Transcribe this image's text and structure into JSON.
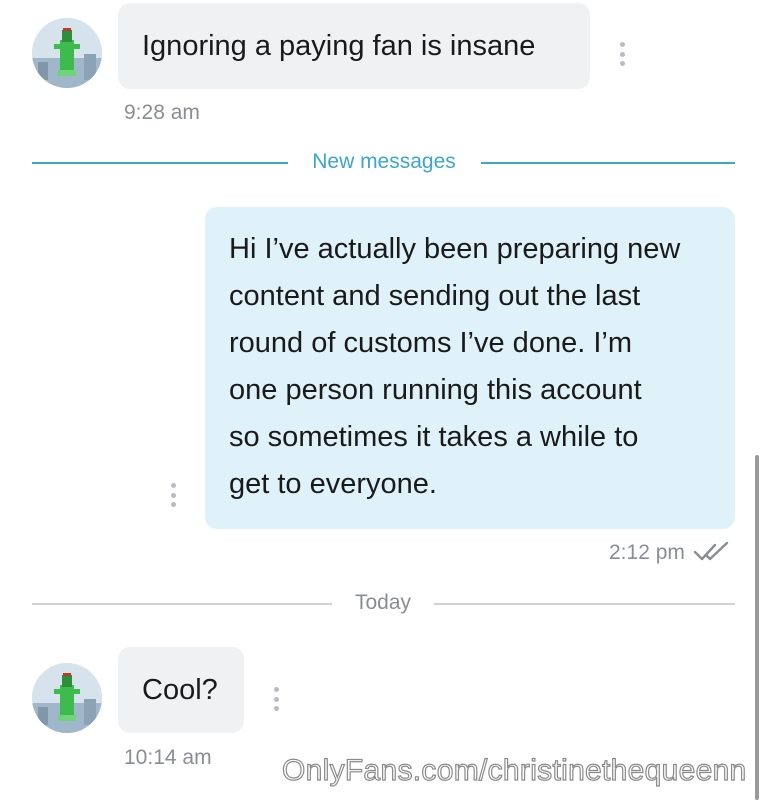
{
  "messages": [
    {
      "direction": "incoming",
      "text": "Ignoring a paying fan is insane",
      "time": "9:28 am"
    },
    {
      "direction": "outgoing",
      "lines": [
        "Hi I’ve actually been preparing new",
        "content and sending out the last",
        "round of customs I’ve done. I’m",
        "one person running this account",
        "so sometimes it takes a while to",
        "get to everyone."
      ],
      "time": "2:12 pm",
      "status_icon": "double-check-icon"
    },
    {
      "direction": "incoming",
      "text": "Cool?",
      "time": "10:14 am"
    }
  ],
  "dividers": {
    "new_messages": "New messages",
    "today": "Today"
  },
  "watermark": "OnlyFans.com/christinethequeenn",
  "colors": {
    "accent": "#3ba7c9",
    "incoming_bubble": "#f0f1f3",
    "outgoing_bubble": "#dff2fa",
    "muted_text": "#8a8d92",
    "divider_gray": "#d0d3d6"
  },
  "icons": {
    "avatar": "avatar-icon",
    "menu": "more-vertical-icon",
    "read_receipt": "double-check-icon"
  }
}
